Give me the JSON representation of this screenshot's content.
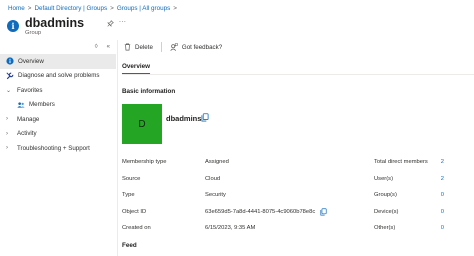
{
  "breadcrumb": [
    "Home",
    "Default Directory | Groups",
    "Groups | All groups"
  ],
  "breadcrumb_separator": ">",
  "header": {
    "title": "dbadmins",
    "subtitle": "Group",
    "more_label": "..."
  },
  "sidebar": {
    "toggle_icons": [
      "sort-icon",
      "collapse-icon"
    ],
    "items": [
      {
        "label": "Overview",
        "icon": "info-icon",
        "active": true
      },
      {
        "label": "Diagnose and solve problems",
        "icon": "wrench-icon"
      },
      {
        "label": "Favorites",
        "expandable": true,
        "expanded": true
      },
      {
        "label": "Members",
        "icon": "people-icon",
        "child": true
      },
      {
        "label": "Manage",
        "expandable": true
      },
      {
        "label": "Activity",
        "expandable": true
      },
      {
        "label": "Troubleshooting + Support",
        "expandable": true
      }
    ]
  },
  "toolbar": {
    "delete_label": "Delete",
    "feedback_label": "Got feedback?"
  },
  "tab": {
    "label": "Overview"
  },
  "basic_info": {
    "title": "Basic information",
    "avatar_letter": "D",
    "group_name": "dbadmins"
  },
  "properties": [
    {
      "label": "Membership type",
      "value": "Assigned"
    },
    {
      "label": "Source",
      "value": "Cloud"
    },
    {
      "label": "Type",
      "value": "Security"
    },
    {
      "label": "Object ID",
      "value": "63e659d5-7a8d-4441-8075-4c9060b78e8c"
    },
    {
      "label": "Created on",
      "value": "6/15/2023, 9:35 AM"
    }
  ],
  "stats": [
    {
      "label": "Total direct members",
      "value": "2"
    },
    {
      "label": "User(s)",
      "value": "2"
    },
    {
      "label": "Group(s)",
      "value": "0"
    },
    {
      "label": "Device(s)",
      "value": "0"
    },
    {
      "label": "Other(s)",
      "value": "0"
    }
  ],
  "feed": {
    "title": "Feed"
  },
  "colors": {
    "accent": "#0f6cbd",
    "avatar_bg": "#24a524",
    "active_nav_bg": "#eaeaea"
  }
}
